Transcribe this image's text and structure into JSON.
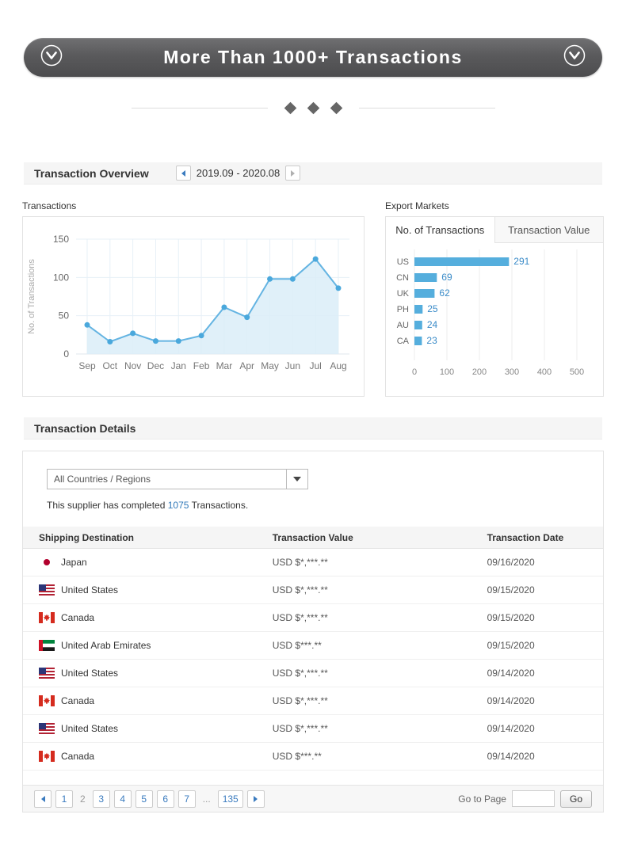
{
  "banner": {
    "title": "More Than 1000+ Transactions"
  },
  "overview": {
    "section_title": "Transaction Overview",
    "date_range": "2019.09 - 2020.08",
    "transactions_label": "Transactions",
    "export_markets_label": "Export Markets",
    "tabs": [
      {
        "label": "No. of Transactions",
        "active": true
      },
      {
        "label": "Transaction Value",
        "active": false
      }
    ]
  },
  "chart_data": [
    {
      "type": "area",
      "title": "Transactions",
      "xlabel": "",
      "ylabel": "No. of Transactions",
      "x": [
        "Sep",
        "Oct",
        "Nov",
        "Dec",
        "Jan",
        "Feb",
        "Mar",
        "Apr",
        "May",
        "Jun",
        "Jul",
        "Aug"
      ],
      "values": [
        38,
        16,
        27,
        17,
        17,
        24,
        61,
        48,
        98,
        98,
        124,
        86
      ],
      "ylim": [
        0,
        150
      ],
      "yticks": [
        0,
        50,
        100,
        150
      ],
      "grid": true,
      "line_color": "#64b4e2",
      "fill_color": "#daedf8",
      "point_color": "#4aa8dc"
    },
    {
      "type": "bar",
      "orientation": "horizontal",
      "title": "Export Markets - No. of Transactions",
      "categories": [
        "US",
        "CN",
        "UK",
        "PH",
        "AU",
        "CA"
      ],
      "values": [
        291,
        69,
        62,
        25,
        24,
        23
      ],
      "xlim": [
        0,
        500
      ],
      "xticks": [
        0,
        100,
        200,
        300,
        400,
        500
      ],
      "grid": true,
      "bar_color": "#55aedd",
      "value_label_color": "#3a8bc8"
    }
  ],
  "details": {
    "section_title": "Transaction Details",
    "filter_selected": "All Countries / Regions",
    "completed_prefix": "This supplier has completed ",
    "completed_count": "1075",
    "completed_suffix": " Transactions.",
    "table": {
      "columns": [
        "Shipping Destination",
        "Transaction Value",
        "Transaction Date"
      ],
      "rows": [
        {
          "country": "Japan",
          "flag": "jp",
          "value": "USD $*,***.**",
          "date": "09/16/2020"
        },
        {
          "country": "United States",
          "flag": "us",
          "value": "USD $*,***.**",
          "date": "09/15/2020"
        },
        {
          "country": "Canada",
          "flag": "ca",
          "value": "USD $*,***.**",
          "date": "09/15/2020"
        },
        {
          "country": "United Arab Emirates",
          "flag": "ae",
          "value": "USD $***.**",
          "date": "09/15/2020"
        },
        {
          "country": "United States",
          "flag": "us",
          "value": "USD $*,***.**",
          "date": "09/14/2020"
        },
        {
          "country": "Canada",
          "flag": "ca",
          "value": "USD $*,***.**",
          "date": "09/14/2020"
        },
        {
          "country": "United States",
          "flag": "us",
          "value": "USD $*,***.**",
          "date": "09/14/2020"
        },
        {
          "country": "Canada",
          "flag": "ca",
          "value": "USD $***.**",
          "date": "09/14/2020"
        }
      ]
    },
    "pagination": {
      "pages": [
        {
          "label": "1",
          "type": "link"
        },
        {
          "label": "2",
          "type": "current"
        },
        {
          "label": "3",
          "type": "link"
        },
        {
          "label": "4",
          "type": "link"
        },
        {
          "label": "5",
          "type": "link"
        },
        {
          "label": "6",
          "type": "link"
        },
        {
          "label": "7",
          "type": "link"
        },
        {
          "label": "...",
          "type": "ellipsis"
        },
        {
          "label": "135",
          "type": "link"
        }
      ],
      "goto_label": "Go to Page",
      "goto_value": "",
      "go_label": "Go"
    }
  },
  "colors": {
    "accent_blue": "#55aedd",
    "link_blue": "#3a7bbf",
    "banner_gray": "#58585a"
  }
}
